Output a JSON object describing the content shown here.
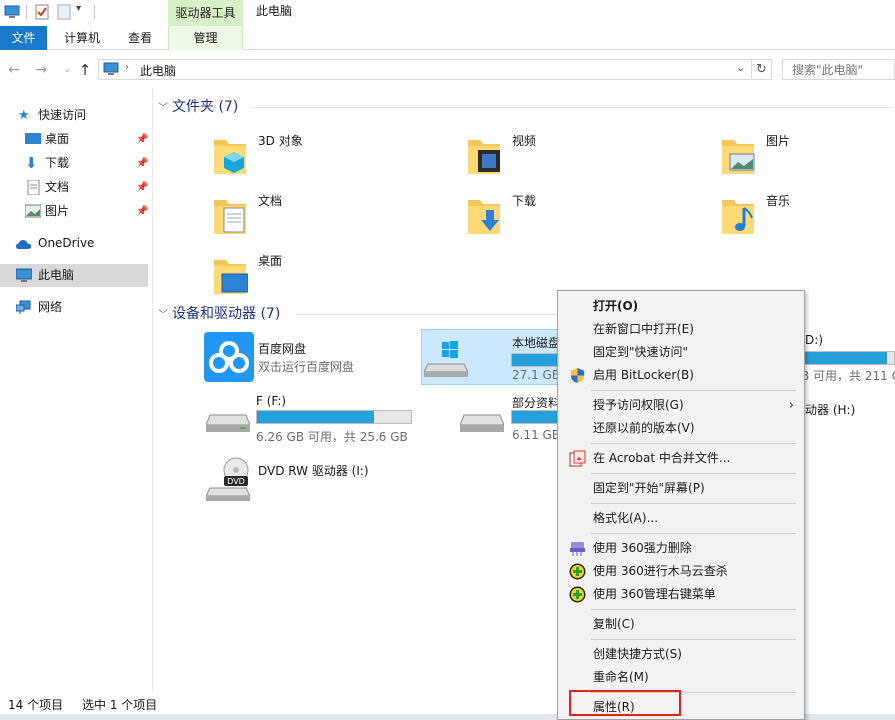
{
  "ribbon": {
    "tabs": [
      "文件",
      "计算机",
      "查看"
    ],
    "context_header": "驱动器工具",
    "context_tab": "管理",
    "window_title": "此电脑"
  },
  "address": {
    "path": "此电脑",
    "search_placeholder": "搜索\"此电脑\""
  },
  "nav": {
    "quick_access": "快速访问",
    "desktop": "桌面",
    "downloads": "下载",
    "documents": "文档",
    "pictures": "图片",
    "onedrive": "OneDrive",
    "this_pc": "此电脑",
    "network": "网络"
  },
  "folders_group": {
    "title": "文件夹 (7)",
    "items": [
      "3D 对象",
      "视频",
      "图片",
      "文档",
      "下载",
      "音乐",
      "桌面"
    ]
  },
  "devices_group": {
    "title": "设备和驱动器 (7)",
    "baidu": {
      "name": "百度网盘",
      "sub": "双击运行百度网盘"
    },
    "drive_c": {
      "name": "本地磁盘",
      "info": "27.1 GB",
      "fill_pct": 70
    },
    "drive_d": {
      "name": ":D:)",
      "info": "B 可用，共 211 G",
      "fill_pct": 92
    },
    "drive_f": {
      "name": "F (F:)",
      "info": "6.26 GB 可用，共 25.6 GB",
      "fill_pct": 76
    },
    "drive_e": {
      "name": "部分资料",
      "info": "6.11 GB",
      "fill_pct": 74
    },
    "drive_h": {
      "name": "动器 (H:)"
    },
    "dvd": {
      "name": "DVD RW 驱动器 (I:)",
      "badge": "DVD"
    }
  },
  "menu": {
    "open": "打开(O)",
    "open_new_window": "在新窗口中打开(E)",
    "pin_quick": "固定到\"快速访问\"",
    "bitlocker": "启用 BitLocker(B)",
    "grant_access": "授予访问权限(G)",
    "restore_prev": "还原以前的版本(V)",
    "acrobat_merge": "在 Acrobat 中合并文件...",
    "pin_start": "固定到\"开始\"屏幕(P)",
    "format": "格式化(A)...",
    "force_delete": "使用 360强力删除",
    "trojan_scan": "使用 360进行木马云查杀",
    "manage_menu": "使用 360管理右键菜单",
    "copy": "复制(C)",
    "create_shortcut": "创建快捷方式(S)",
    "rename": "重命名(M)",
    "properties": "属性(R)"
  },
  "status": {
    "count": "14 个项目",
    "selected": "选中 1 个项目"
  },
  "colors": {
    "accent": "#1979ca",
    "drive_bar": "#26a0da",
    "selection": "#cce8ff",
    "highlight_box": "#e0231c"
  }
}
